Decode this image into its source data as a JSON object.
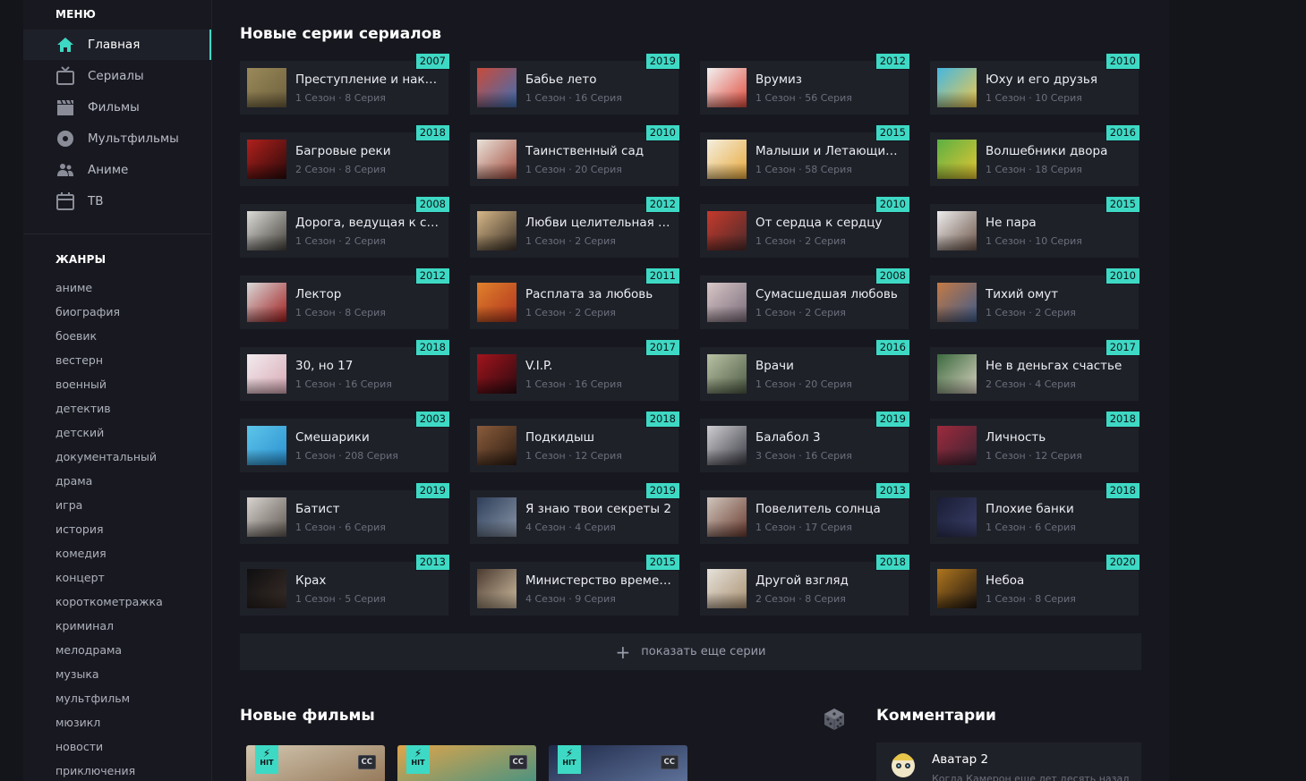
{
  "sidebar": {
    "menu_title": "МЕНЮ",
    "menu": [
      {
        "label": "Главная",
        "icon": "home-icon",
        "active": true
      },
      {
        "label": "Сериалы",
        "icon": "tv-icon",
        "active": false
      },
      {
        "label": "Фильмы",
        "icon": "clapperboard-icon",
        "active": false
      },
      {
        "label": "Мультфильмы",
        "icon": "disc-icon",
        "active": false
      },
      {
        "label": "Аниме",
        "icon": "people-icon",
        "active": false
      },
      {
        "label": "ТВ",
        "icon": "calendar-icon",
        "active": false
      }
    ],
    "genres_title": "ЖАНРЫ",
    "genres": [
      "аниме",
      "биография",
      "боевик",
      "вестерн",
      "военный",
      "детектив",
      "детский",
      "документальный",
      "драма",
      "игра",
      "история",
      "комедия",
      "концерт",
      "короткометражка",
      "криминал",
      "мелодрама",
      "музыка",
      "мультфильм",
      "мюзикл",
      "новости",
      "приключения"
    ]
  },
  "main": {
    "series_title": "Новые серии сериалов",
    "series": [
      {
        "title": "Преступление и наказ…",
        "sub": "1 Сезон · 8 Серия",
        "year": "2007",
        "thumb": [
          "#9a8a5a",
          "#6d5f3c"
        ]
      },
      {
        "title": "Бабье лето",
        "sub": "1 Сезон · 16 Серия",
        "year": "2019",
        "thumb": [
          "#c94b3a",
          "#3d6fb5"
        ]
      },
      {
        "title": "Врумиз",
        "sub": "1 Сезон · 56 Серия",
        "year": "2012",
        "thumb": [
          "#f2f2f2",
          "#e04a3b"
        ]
      },
      {
        "title": "Юху и его друзья",
        "sub": "1 Сезон · 10 Серия",
        "year": "2010",
        "thumb": [
          "#45b7e0",
          "#f2c84b"
        ]
      },
      {
        "title": "Багровые реки",
        "sub": "2 Сезон · 8 Серия",
        "year": "2018",
        "thumb": [
          "#b0201c",
          "#2a0a0a"
        ]
      },
      {
        "title": "Таинственный сад",
        "sub": "1 Сезон · 20 Серия",
        "year": "2010",
        "thumb": [
          "#e9e3da",
          "#a34a3c"
        ]
      },
      {
        "title": "Малыши и Летающие …",
        "sub": "1 Сезон · 58 Серия",
        "year": "2015",
        "thumb": [
          "#f4efe0",
          "#e8a93a"
        ]
      },
      {
        "title": "Волшебники двора",
        "sub": "1 Сезон · 18 Серия",
        "year": "2016",
        "thumb": [
          "#5bb043",
          "#e6c632"
        ]
      },
      {
        "title": "Дорога, ведущая к сча…",
        "sub": "1 Сезон · 2 Серия",
        "year": "2008",
        "thumb": [
          "#dcdcd8",
          "#44403a"
        ]
      },
      {
        "title": "Любви целительная си…",
        "sub": "1 Сезон · 2 Серия",
        "year": "2012",
        "thumb": [
          "#d7b889",
          "#3a3026"
        ]
      },
      {
        "title": "От сердца к сердцу",
        "sub": "1 Сезон · 2 Серия",
        "year": "2010",
        "thumb": [
          "#c63a2c",
          "#4a2a2a"
        ]
      },
      {
        "title": "Не пара",
        "sub": "1 Сезон · 10 Серия",
        "year": "2015",
        "thumb": [
          "#eeeeee",
          "#6a5246"
        ]
      },
      {
        "title": "Лектор",
        "sub": "1 Сезон · 8 Серия",
        "year": "2012",
        "thumb": [
          "#d9d9d9",
          "#a11d1d"
        ]
      },
      {
        "title": "Расплата за любовь",
        "sub": "1 Сезон · 2 Серия",
        "year": "2011",
        "thumb": [
          "#e0812b",
          "#b0331f"
        ]
      },
      {
        "title": "Сумасшедшая любовь",
        "sub": "1 Сезон · 2 Серия",
        "year": "2008",
        "thumb": [
          "#d8c8c8",
          "#7a6a78"
        ]
      },
      {
        "title": "Тихий омут",
        "sub": "1 Сезон · 2 Серия",
        "year": "2010",
        "thumb": [
          "#c47a45",
          "#3e5b8a"
        ]
      },
      {
        "title": "30, но 17",
        "sub": "1 Сезон · 16 Серия",
        "year": "2018",
        "thumb": [
          "#f2ecef",
          "#d8a8b4"
        ]
      },
      {
        "title": "V.I.P.",
        "sub": "1 Сезон · 16 Серия",
        "year": "2017",
        "thumb": [
          "#a2141c",
          "#2a0a10"
        ]
      },
      {
        "title": "Врачи",
        "sub": "1 Сезон · 20 Серия",
        "year": "2016",
        "thumb": [
          "#b8c2a4",
          "#4d5a43"
        ]
      },
      {
        "title": "Не в деньгах счастье",
        "sub": "2 Сезон · 4 Серия",
        "year": "2017",
        "thumb": [
          "#3b6a3e",
          "#d9d2c0"
        ]
      },
      {
        "title": "Смешарики",
        "sub": "1 Сезон · 208 Серия",
        "year": "2003",
        "thumb": [
          "#5dc6ea",
          "#2a8fd0"
        ]
      },
      {
        "title": "Подкидыш",
        "sub": "1 Сезон · 12 Серия",
        "year": "2018",
        "thumb": [
          "#8a5c3c",
          "#2e1d12"
        ]
      },
      {
        "title": "Балабол 3",
        "sub": "3 Сезон · 16 Серия",
        "year": "2019",
        "thumb": [
          "#cfcfd2",
          "#3a3a44"
        ]
      },
      {
        "title": "Личность",
        "sub": "1 Сезон · 12 Серия",
        "year": "2018",
        "thumb": [
          "#9e2a3d",
          "#3a2432"
        ]
      },
      {
        "title": "Батист",
        "sub": "1 Сезон · 6 Серия",
        "year": "2019",
        "thumb": [
          "#d8d4cf",
          "#5e5650"
        ]
      },
      {
        "title": "Я знаю твои секреты 2",
        "sub": "4 Сезон · 4 Серия",
        "year": "2019",
        "thumb": [
          "#2e3f5a",
          "#8a96a8"
        ]
      },
      {
        "title": "Повелитель солнца",
        "sub": "1 Сезон · 17 Серия",
        "year": "2013",
        "thumb": [
          "#cfc6bd",
          "#6a3a2e"
        ]
      },
      {
        "title": "Плохие банки",
        "sub": "1 Сезон · 6 Серия",
        "year": "2018",
        "thumb": [
          "#1a1d34",
          "#3a3f6a"
        ]
      },
      {
        "title": "Крах",
        "sub": "1 Сезон · 5 Серия",
        "year": "2013",
        "thumb": [
          "#0e0e10",
          "#3a2e28"
        ]
      },
      {
        "title": "Министерство времени",
        "sub": "4 Сезон · 9 Серия",
        "year": "2015",
        "thumb": [
          "#4a3a30",
          "#d2bfa2"
        ]
      },
      {
        "title": "Другой взгляд",
        "sub": "2 Сезон · 8 Серия",
        "year": "2018",
        "thumb": [
          "#e6e2db",
          "#a98f6f"
        ]
      },
      {
        "title": "Небоа",
        "sub": "1 Сезон · 8 Серия",
        "year": "2020",
        "thumb": [
          "#b0761e",
          "#1e1610"
        ]
      }
    ],
    "more_label": "показать еще серии",
    "films_title": "Новые фильмы",
    "films": [
      {
        "hit": "HIT",
        "cc": "CC",
        "thumb": [
          "#d2c7b0",
          "#8a6a4a"
        ]
      },
      {
        "hit": "HIT",
        "cc": "CC",
        "thumb": [
          "#e0a54a",
          "#2f8f8a"
        ]
      },
      {
        "hit": "HIT",
        "cc": "CC",
        "thumb": [
          "#1f2a4a",
          "#6a7fa8"
        ]
      }
    ],
    "comments_title": "Комментарии",
    "comment": {
      "title": "Аватар 2",
      "text": "Когда Камерон еще лет десять назад"
    }
  },
  "colors": {
    "accent": "#3ed9c4",
    "bg": "#14151b",
    "card": "#1f2129"
  }
}
